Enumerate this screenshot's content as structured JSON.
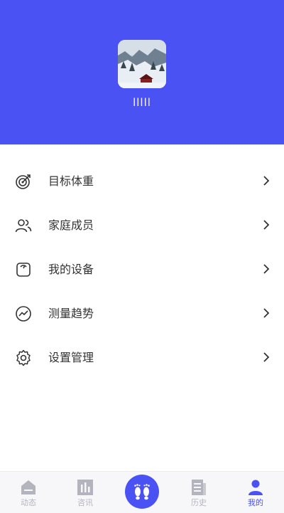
{
  "profile": {
    "username": "lllll"
  },
  "menu": [
    {
      "label": "目标体重",
      "icon": "target-icon"
    },
    {
      "label": "家庭成员",
      "icon": "family-icon"
    },
    {
      "label": "我的设备",
      "icon": "scale-icon"
    },
    {
      "label": "测量趋势",
      "icon": "trend-icon"
    },
    {
      "label": "设置管理",
      "icon": "gear-icon"
    }
  ],
  "tabbar": {
    "tabs": [
      {
        "label": "动态",
        "icon": "home-icon",
        "active": false
      },
      {
        "label": "咨讯",
        "icon": "chart-icon",
        "active": false
      },
      {
        "label": "",
        "icon": "footprints-icon",
        "active": false
      },
      {
        "label": "历史",
        "icon": "document-icon",
        "active": false
      },
      {
        "label": "我的",
        "icon": "user-icon",
        "active": true
      }
    ]
  },
  "colors": {
    "primary": "#4a52f3",
    "inactive": "#b4b4be",
    "text": "#333333"
  }
}
